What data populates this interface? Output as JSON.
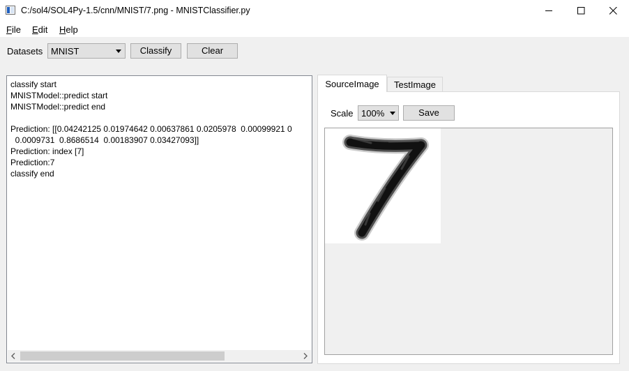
{
  "window": {
    "title": "C:/sol4/SOL4Py-1.5/cnn/MNIST/7.png - MNISTClassifier.py"
  },
  "menu": {
    "file": {
      "first": "F",
      "rest": "ile"
    },
    "edit": {
      "first": "E",
      "rest": "dit"
    },
    "help": {
      "first": "H",
      "rest": "elp"
    }
  },
  "toolbar": {
    "datasets_label": "Datasets",
    "datasets_value": "MNIST",
    "classify_label": "Classify",
    "clear_label": "Clear"
  },
  "log": {
    "lines": [
      "classify start",
      "MNISTModel::predict start",
      "MNISTModel::predict end",
      "",
      "Prediction: [[0.04242125 0.01974642 0.00637861 0.0205978  0.00099921 0",
      "  0.0009731  0.8686514  0.00183907 0.03427093]]",
      "Prediction: index [7]",
      "Prediction:7",
      "classify end"
    ]
  },
  "tabs": {
    "source": "SourceImage",
    "test": "TestImage"
  },
  "image_panel": {
    "scale_label": "Scale",
    "scale_value": "100%",
    "save_label": "Save"
  },
  "colors": {
    "accent": "#0078d7",
    "window_bg": "#f0f0f0",
    "button_bg": "#e1e1e1",
    "button_border": "#adadad"
  },
  "icons": {
    "app": "app-window-icon",
    "minimize": "minimize-icon",
    "maximize": "maximize-icon",
    "close": "close-icon",
    "dropdown": "chevron-down-icon",
    "scroll_left": "scroll-left-arrow-icon",
    "scroll_right": "scroll-right-arrow-icon"
  }
}
